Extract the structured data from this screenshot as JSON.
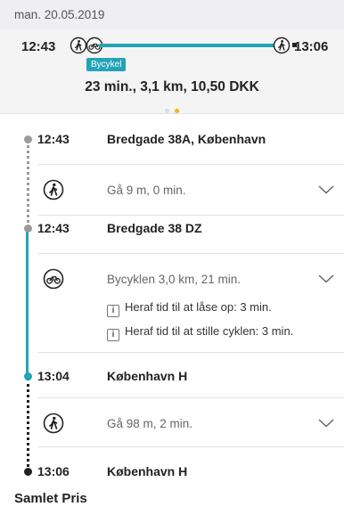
{
  "date_label": "man. 20.05.2019",
  "summary": {
    "start_time": "12:43",
    "end_time": "13:06",
    "bike_badge": "Bycykel",
    "info": "23 min.,  3,1 km,  10,50 DKK",
    "icons": [
      "walk-icon",
      "bike-icon",
      "walk-icon"
    ],
    "accent_color": "#23a3b6",
    "active_page": 2,
    "page_count": 2
  },
  "route": {
    "stops": [
      {
        "time": "12:43",
        "place": "Bredgade 38A, København"
      },
      {
        "time": "12:43",
        "place": "Bredgade 38 DZ"
      },
      {
        "time": "13:04",
        "place": "København H"
      },
      {
        "time": "13:06",
        "place": "København H"
      }
    ],
    "legs": [
      {
        "icon": "walk-icon",
        "text": "Gå 9 m, 0 min."
      },
      {
        "icon": "bike-icon",
        "text": "Bycyklen 3,0 km, 21 min.",
        "notes": [
          "Heraf tid til at låse op: 3 min.",
          "Heraf tid til at stille cyklen: 3 min."
        ]
      },
      {
        "icon": "walk-icon",
        "text": "Gå 98 m, 2 min."
      }
    ]
  },
  "total_title": "Samlet Pris"
}
